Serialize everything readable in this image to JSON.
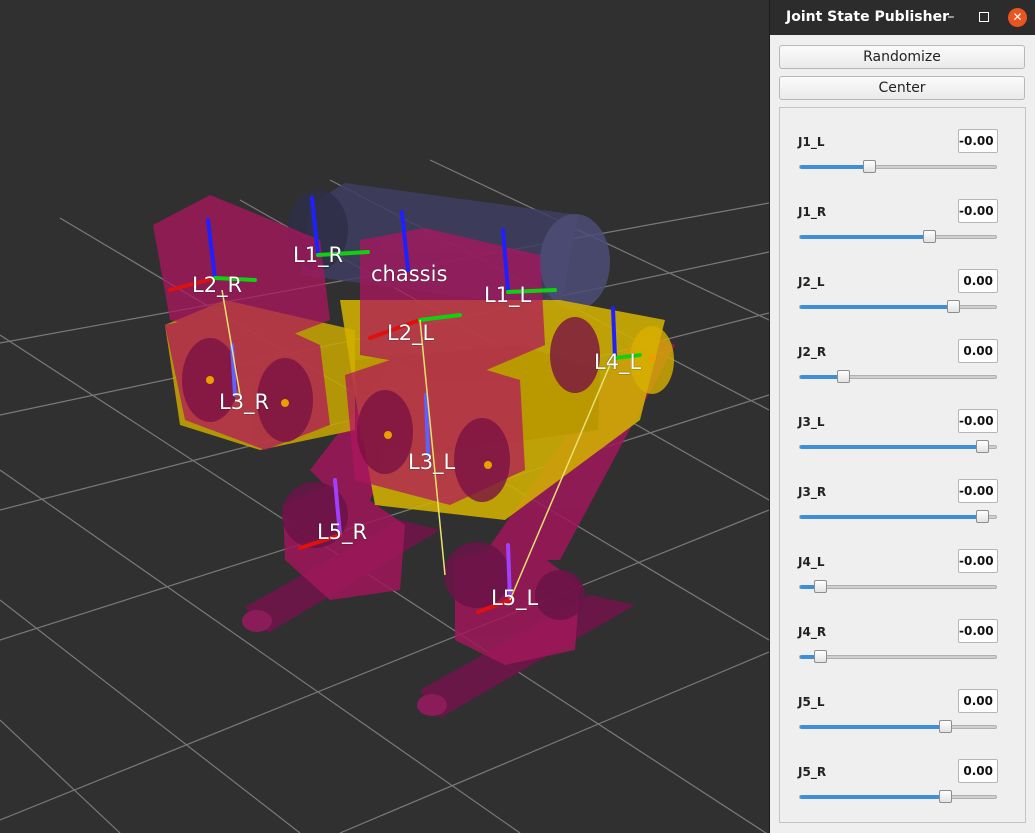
{
  "window": {
    "title": "Joint State Publisher",
    "minimize_icon": "minimize-icon",
    "maximize_icon": "maximize-icon",
    "close_icon": "close-icon",
    "close_glyph": "✕",
    "minimize_glyph": "–",
    "accent_color": "#e95420"
  },
  "buttons": {
    "randomize": "Randomize",
    "center": "Center"
  },
  "joints": [
    {
      "name": "J1_L",
      "value": "-0.00",
      "position": 0.35
    },
    {
      "name": "J1_R",
      "value": "-0.00",
      "position": 0.66
    },
    {
      "name": "J2_L",
      "value": "0.00",
      "position": 0.78
    },
    {
      "name": "J2_R",
      "value": "0.00",
      "position": 0.22
    },
    {
      "name": "J3_L",
      "value": "-0.00",
      "position": 0.93
    },
    {
      "name": "J3_R",
      "value": "-0.00",
      "position": 0.93
    },
    {
      "name": "J4_L",
      "value": "-0.00",
      "position": 0.1
    },
    {
      "name": "J4_R",
      "value": "-0.00",
      "position": 0.1
    },
    {
      "name": "J5_L",
      "value": "0.00",
      "position": 0.74
    },
    {
      "name": "J5_R",
      "value": "0.00",
      "position": 0.74
    }
  ],
  "scene": {
    "labels": {
      "l1_r": "L1_R",
      "chassis": "chassis",
      "l2_r": "L2_R",
      "l1_l": "L1_L",
      "l2_l": "L2_L",
      "l4_l": "L4_L",
      "l3_r": "L3_R",
      "l3_l": "L3_L",
      "l5_r": "L5_R",
      "l5_l": "L5_L"
    },
    "background_color": "#303030",
    "link_color": "#c2185b",
    "body_color": "#d4b000",
    "chassis_color": "#3a3a5a"
  }
}
